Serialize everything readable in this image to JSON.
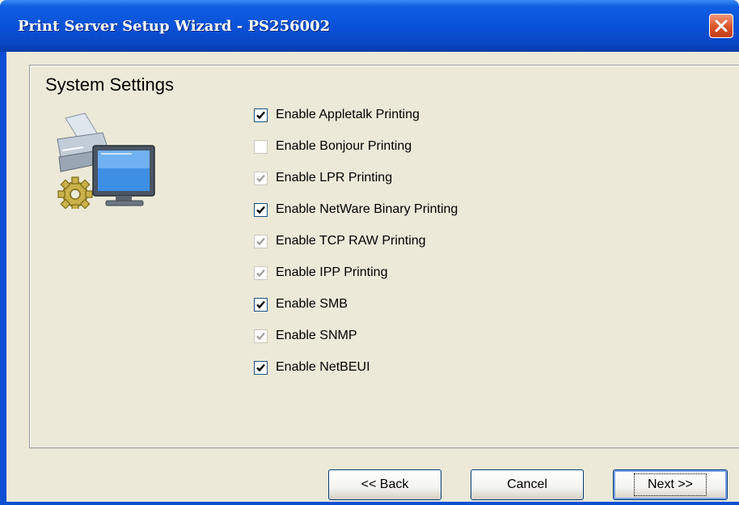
{
  "window": {
    "title": "Print Server Setup Wizard - PS256002",
    "close_icon": "close-icon"
  },
  "section": {
    "title": "System Settings",
    "icon": "printer-monitor-gear-icon"
  },
  "options": [
    {
      "label": "Enable Appletalk Printing",
      "checked": true,
      "enabled": true
    },
    {
      "label": "Enable Bonjour Printing",
      "checked": false,
      "enabled": false
    },
    {
      "label": "Enable LPR Printing",
      "checked": true,
      "enabled": false
    },
    {
      "label": "Enable NetWare Binary Printing",
      "checked": true,
      "enabled": true
    },
    {
      "label": "Enable TCP RAW Printing",
      "checked": true,
      "enabled": false
    },
    {
      "label": "Enable IPP Printing",
      "checked": true,
      "enabled": false
    },
    {
      "label": "Enable SMB",
      "checked": true,
      "enabled": true
    },
    {
      "label": "Enable SNMP",
      "checked": true,
      "enabled": false
    },
    {
      "label": "Enable NetBEUI",
      "checked": true,
      "enabled": true
    }
  ],
  "buttons": {
    "back": "<< Back",
    "cancel": "Cancel",
    "next": ">>"
  },
  "buttons_next_label": "Next >>",
  "colors": {
    "titlebar": "#0a52d8",
    "client_bg": "#ece9d8",
    "check_enabled": "#000000",
    "check_disabled": "#a3a39c"
  }
}
